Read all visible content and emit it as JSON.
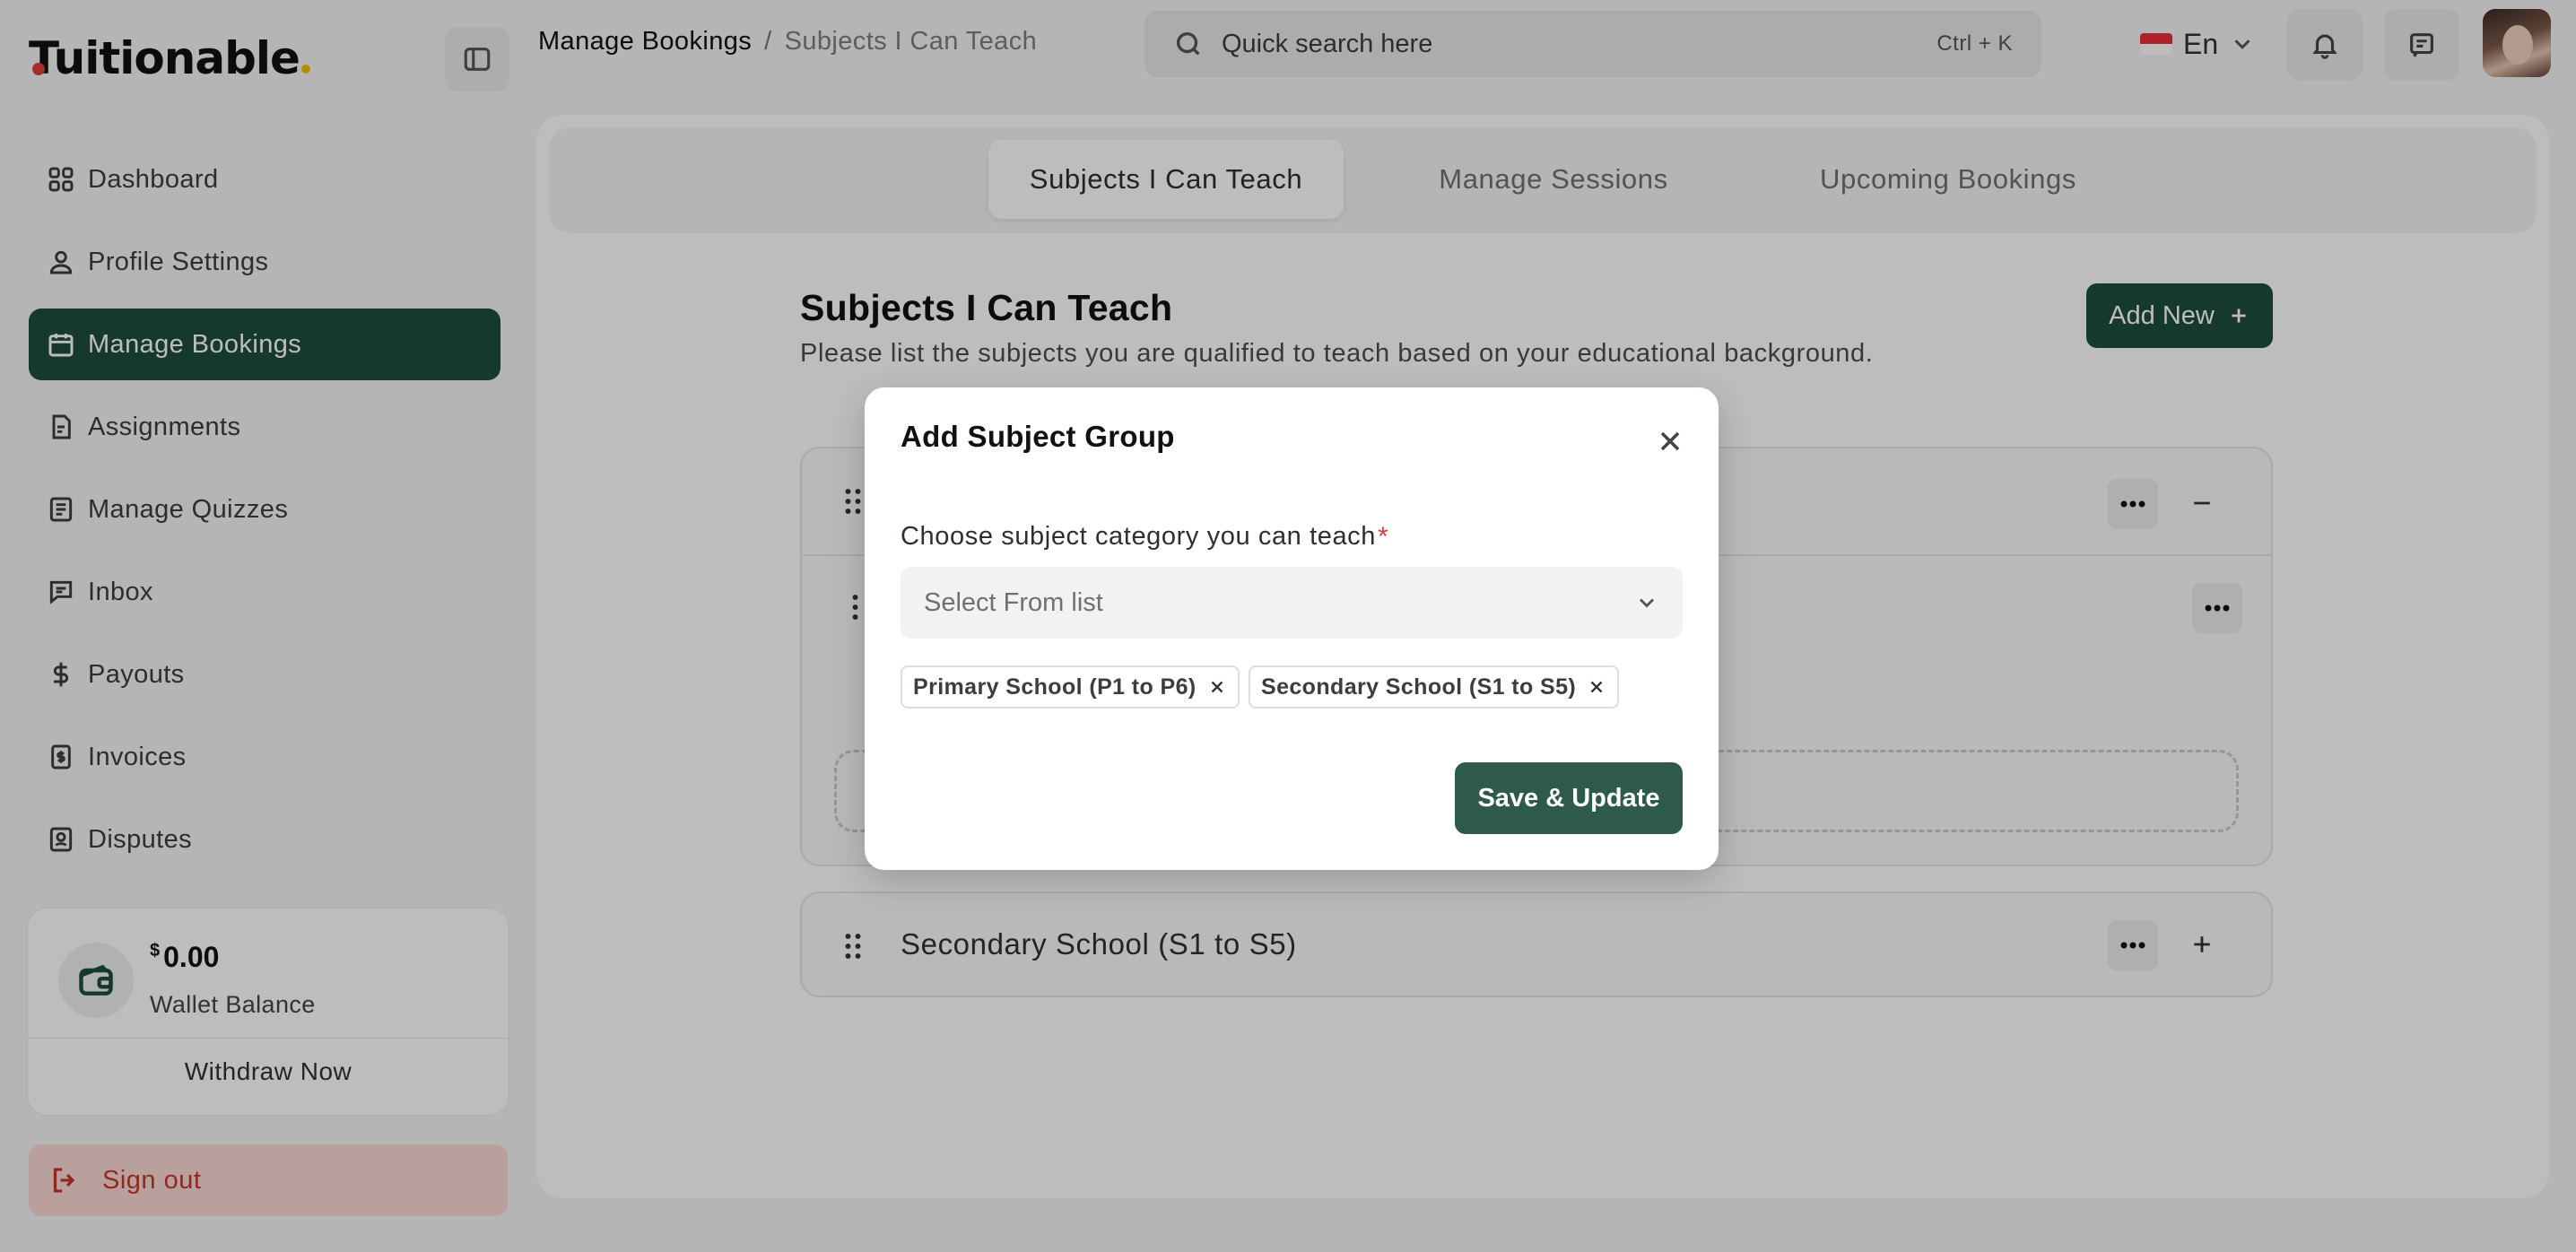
{
  "brand": {
    "name": "Tuitionable"
  },
  "sidebar": {
    "items": [
      {
        "label": "Dashboard",
        "icon": "grid-icon"
      },
      {
        "label": "Profile Settings",
        "icon": "user-icon"
      },
      {
        "label": "Manage Bookings",
        "icon": "calendar-icon",
        "active": true
      },
      {
        "label": "Assignments",
        "icon": "assignment-icon"
      },
      {
        "label": "Manage Quizzes",
        "icon": "quiz-icon"
      },
      {
        "label": "Inbox",
        "icon": "chat-icon"
      },
      {
        "label": "Payouts",
        "icon": "dollar-icon"
      },
      {
        "label": "Invoices",
        "icon": "invoice-icon"
      },
      {
        "label": "Disputes",
        "icon": "dispute-icon"
      }
    ],
    "wallet": {
      "currency": "$",
      "amount": "0.00",
      "label": "Wallet Balance",
      "withdraw": "Withdraw Now"
    },
    "signout": "Sign out"
  },
  "header": {
    "breadcrumb": {
      "current": "Manage Bookings",
      "separator": "/",
      "last": "Subjects I Can Teach"
    },
    "search": {
      "placeholder": "Quick search here",
      "shortcut": "Ctrl + K"
    },
    "language": "En"
  },
  "main": {
    "tabs": [
      {
        "label": "Subjects I Can Teach",
        "active": true
      },
      {
        "label": "Manage Sessions"
      },
      {
        "label": "Upcoming Bookings"
      }
    ],
    "title": "Subjects I Can Teach",
    "subtitle": "Please list the subjects you are qualified to teach based on your educational background.",
    "add_new": "Add New",
    "groups": [
      {
        "title": "Secondary School (S1 to S5)"
      }
    ]
  },
  "modal": {
    "title": "Add Subject Group",
    "field_label": "Choose subject category you can teach",
    "required_mark": "*",
    "select_placeholder": "Select From list",
    "chips": [
      "Primary School (P1 to P6)",
      "Secondary School (S1 to S5)"
    ],
    "save_label": "Save & Update"
  },
  "colors": {
    "primary": "#1d4d3b",
    "danger": "#c0392b",
    "danger_bg": "#fbd8d3",
    "save": "#2d5a4b"
  }
}
